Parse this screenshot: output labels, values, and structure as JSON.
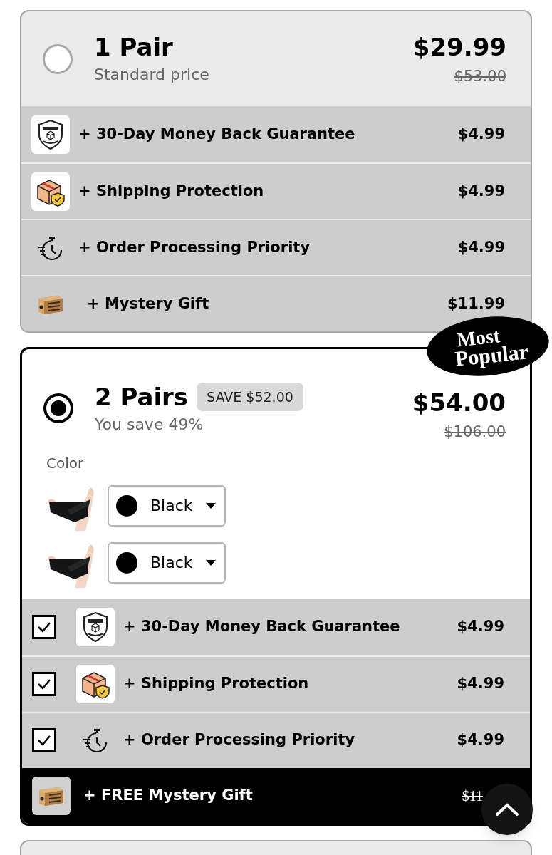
{
  "bundles": [
    {
      "title": "1 Pair",
      "subtitle": "Standard price",
      "price": "$29.99",
      "compare_price": "$53.00",
      "selected": false,
      "addons": [
        {
          "kind": "warranty",
          "label": "+ 30-Day Money Back Guarantee",
          "price": "$4.99"
        },
        {
          "kind": "shipping",
          "label": "+ Shipping Protection",
          "price": "$4.99"
        },
        {
          "kind": "timer",
          "label": "+ Order Processing Priority",
          "price": "$4.99"
        },
        {
          "kind": "mystery",
          "label": "+ Mystery Gift",
          "price": "$11.99"
        }
      ]
    },
    {
      "title": "2 Pairs",
      "save_badge": "SAVE $52.00",
      "subtitle": "You save 49%",
      "price": "$54.00",
      "compare_price": "$106.00",
      "selected": true,
      "ribbon": [
        "Most",
        "Popular"
      ],
      "color_label": "Color",
      "variants": [
        {
          "value": "Black",
          "color": "#000000"
        },
        {
          "value": "Black",
          "color": "#000000"
        }
      ],
      "addons": [
        {
          "kind": "warranty",
          "label": "+ 30-Day Money Back Guarantee",
          "price": "$4.99",
          "checked": true
        },
        {
          "kind": "shipping",
          "label": "+ Shipping Protection",
          "price": "$4.99",
          "checked": true
        },
        {
          "kind": "timer",
          "label": "+ Order Processing Priority",
          "price": "$4.99",
          "checked": true
        }
      ],
      "free_gift": {
        "kind": "mystery",
        "label": "+ FREE Mystery Gift",
        "compare_price": "$11"
      }
    }
  ]
}
